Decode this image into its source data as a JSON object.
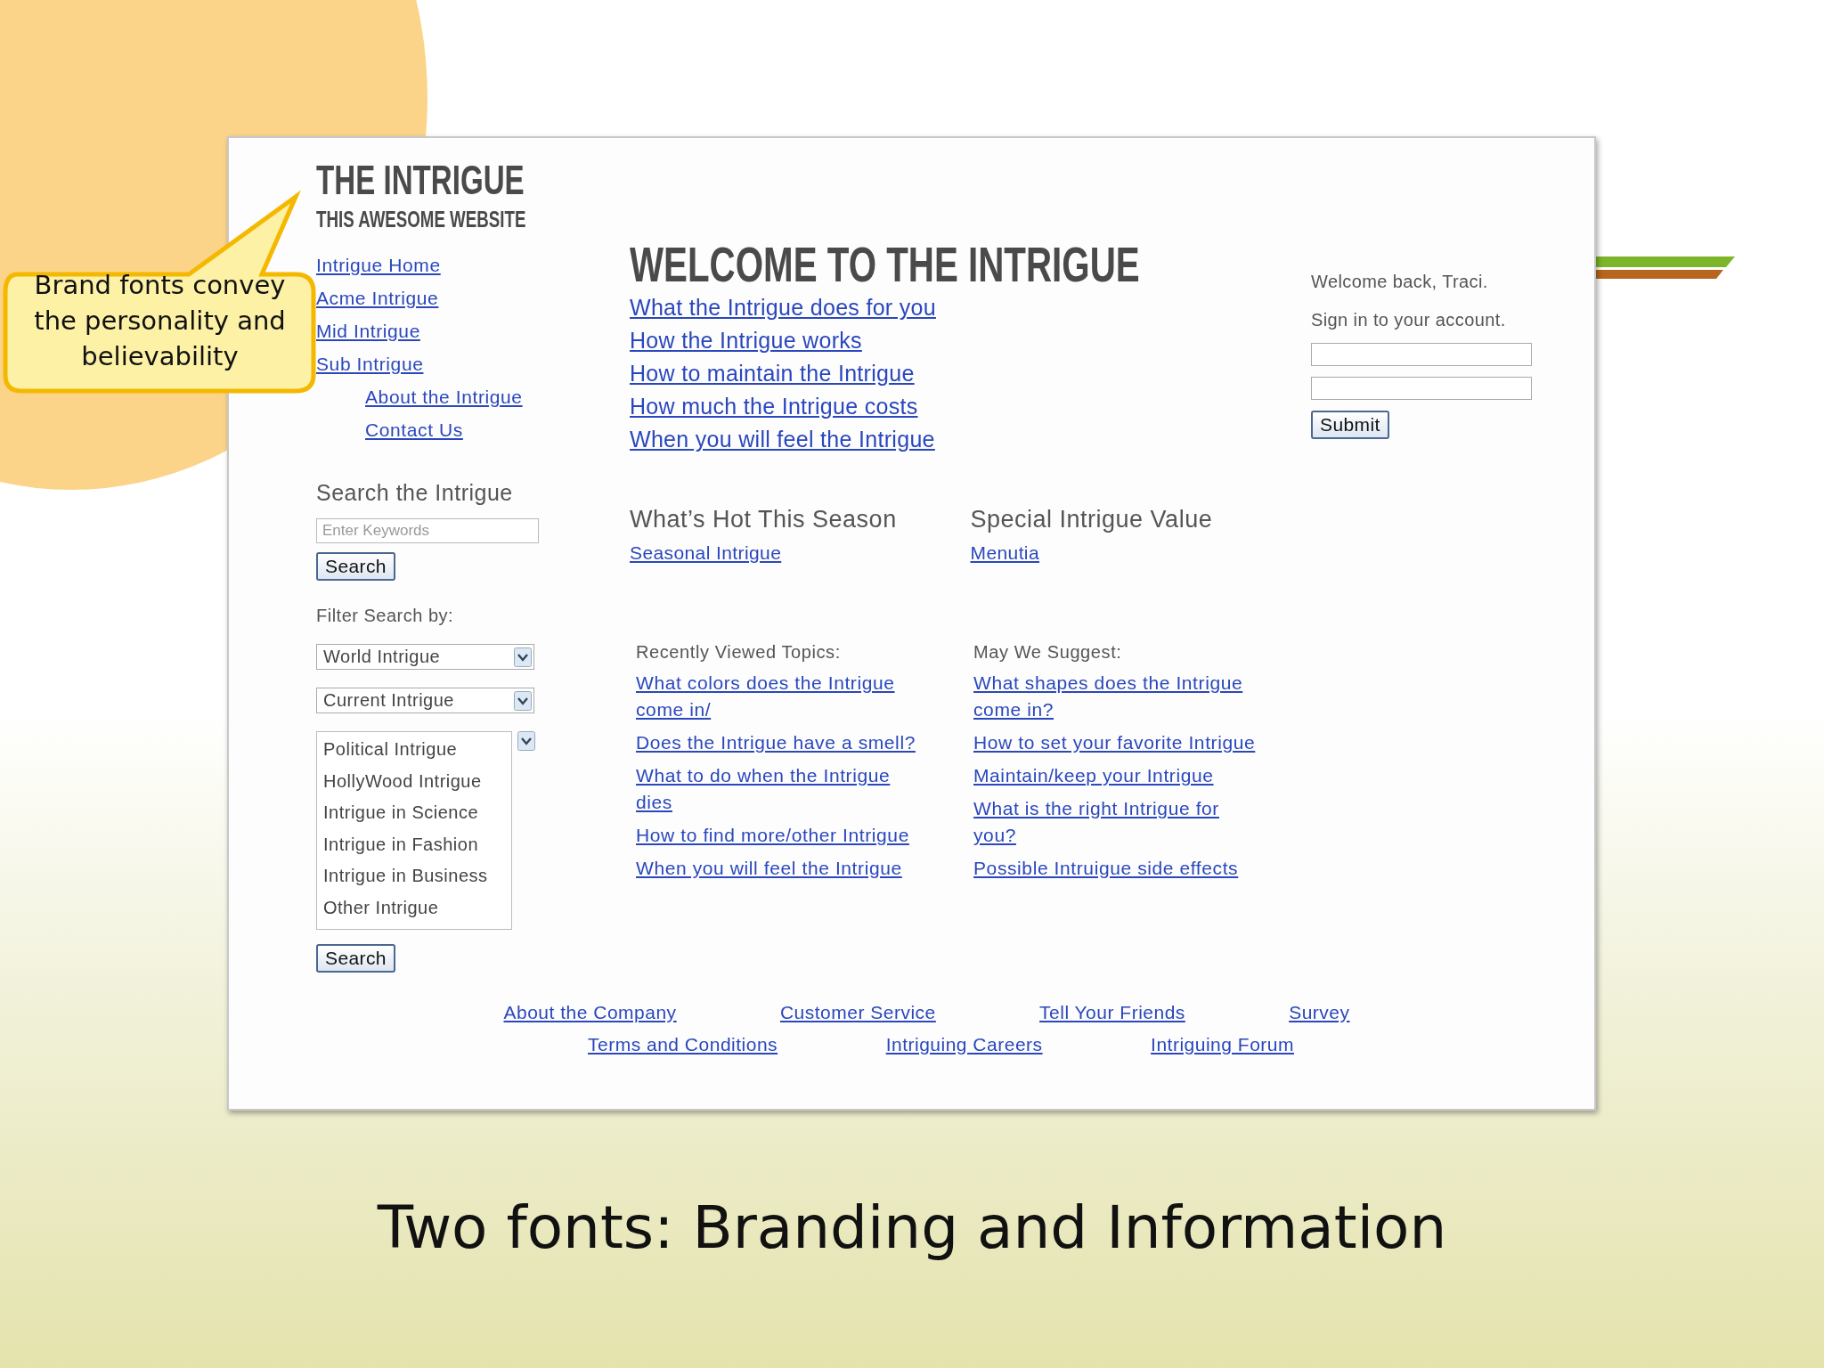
{
  "slide": {
    "callout": "Brand fonts convey the personality and believability",
    "caption": "Two fonts: Branding and Information"
  },
  "site": {
    "title": "THE INTRIGUE",
    "tagline": "THIS AWESOME WEBSITE"
  },
  "nav": [
    {
      "label": "Intrigue Home"
    },
    {
      "label": "Acme Intrigue"
    },
    {
      "label": "Mid Intrigue"
    },
    {
      "label": "Sub Intrigue",
      "children": [
        {
          "label": "About the Intrigue"
        },
        {
          "label": "Contact Us"
        }
      ]
    }
  ],
  "search": {
    "heading": "Search the Intrigue",
    "placeholder": "Enter Keywords",
    "button": "Search",
    "filter_label": "Filter Search by:",
    "selects": [
      {
        "value": "World Intrigue"
      },
      {
        "value": "Current Intrigue"
      }
    ],
    "listbox": [
      "Political Intrigue",
      "HollyWood Intrigue",
      "Intrigue in Science",
      "Intrigue in Fashion",
      "Intrigue in Business",
      "Other Intrigue"
    ],
    "button_2": "Search"
  },
  "welcome": {
    "heading": "WELCOME TO THE INTRIGUE",
    "links": [
      "What the Intrigue does for you",
      "How the Intrigue works",
      "How to maintain the Intrigue",
      "How much the Intrigue costs",
      "When you will feel the Intrigue"
    ]
  },
  "features": [
    {
      "heading": "What’s Hot This Season",
      "link": "Seasonal Intrigue"
    },
    {
      "heading": "Special Intrigue Value",
      "link": "Menutia"
    }
  ],
  "topics": [
    {
      "heading": "Recently Viewed Topics:",
      "links": [
        "What colors does the Intrigue come in/",
        "Does the Intrigue have a smell?",
        "What to do when the Intrigue dies",
        "How to find more/other Intrigue",
        "When you will feel the Intrigue"
      ]
    },
    {
      "heading": "May We Suggest:",
      "links": [
        "What shapes does the Intrigue come in?",
        "How to set your favorite Intrigue",
        "Maintain/keep your Intrigue",
        "What is the right Intrigue for you?",
        "Possible Intruigue side effects"
      ]
    }
  ],
  "account": {
    "greeting": "Welcome back, Traci.",
    "prompt": "Sign in to your account.",
    "button": "Submit"
  },
  "footer": [
    [
      "About the Company",
      "Customer Service",
      "Tell Your Friends",
      "Survey"
    ],
    [
      "Terms and Conditions",
      "Intriguing Careers",
      "Intriguing Forum"
    ]
  ]
}
